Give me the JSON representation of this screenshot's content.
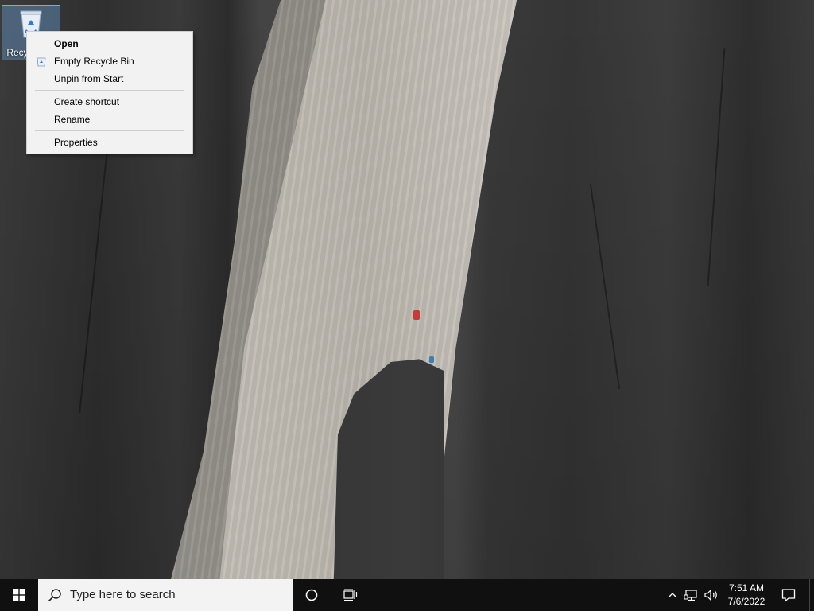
{
  "desktop": {
    "icons": [
      {
        "label": "Recycle Bin",
        "icon": "recycle-bin-icon"
      }
    ]
  },
  "context_menu": {
    "items": [
      {
        "label": "Open",
        "bold": true
      },
      {
        "label": "Empty Recycle Bin",
        "icon": "recycle-bin-small-icon"
      },
      {
        "label": "Unpin from Start"
      },
      {
        "label": "Create shortcut"
      },
      {
        "label": "Rename"
      },
      {
        "label": "Properties"
      }
    ]
  },
  "taskbar": {
    "start_icon": "windows-logo-icon",
    "search_placeholder": "Type here to search",
    "cortana_icon": "cortana-circle-icon",
    "task_view_icon": "task-view-icon",
    "tray": {
      "chevron_icon": "chevron-up-icon",
      "network_icon": "network-icon",
      "volume_icon": "volume-icon",
      "time": "7:51 AM",
      "date": "7/6/2022",
      "notification_icon": "action-center-icon"
    }
  },
  "colors": {
    "taskbar_bg": "#101010",
    "search_bg": "#f3f3f3",
    "menu_bg": "#f2f2f2",
    "icon_selection": "#6496c8"
  }
}
